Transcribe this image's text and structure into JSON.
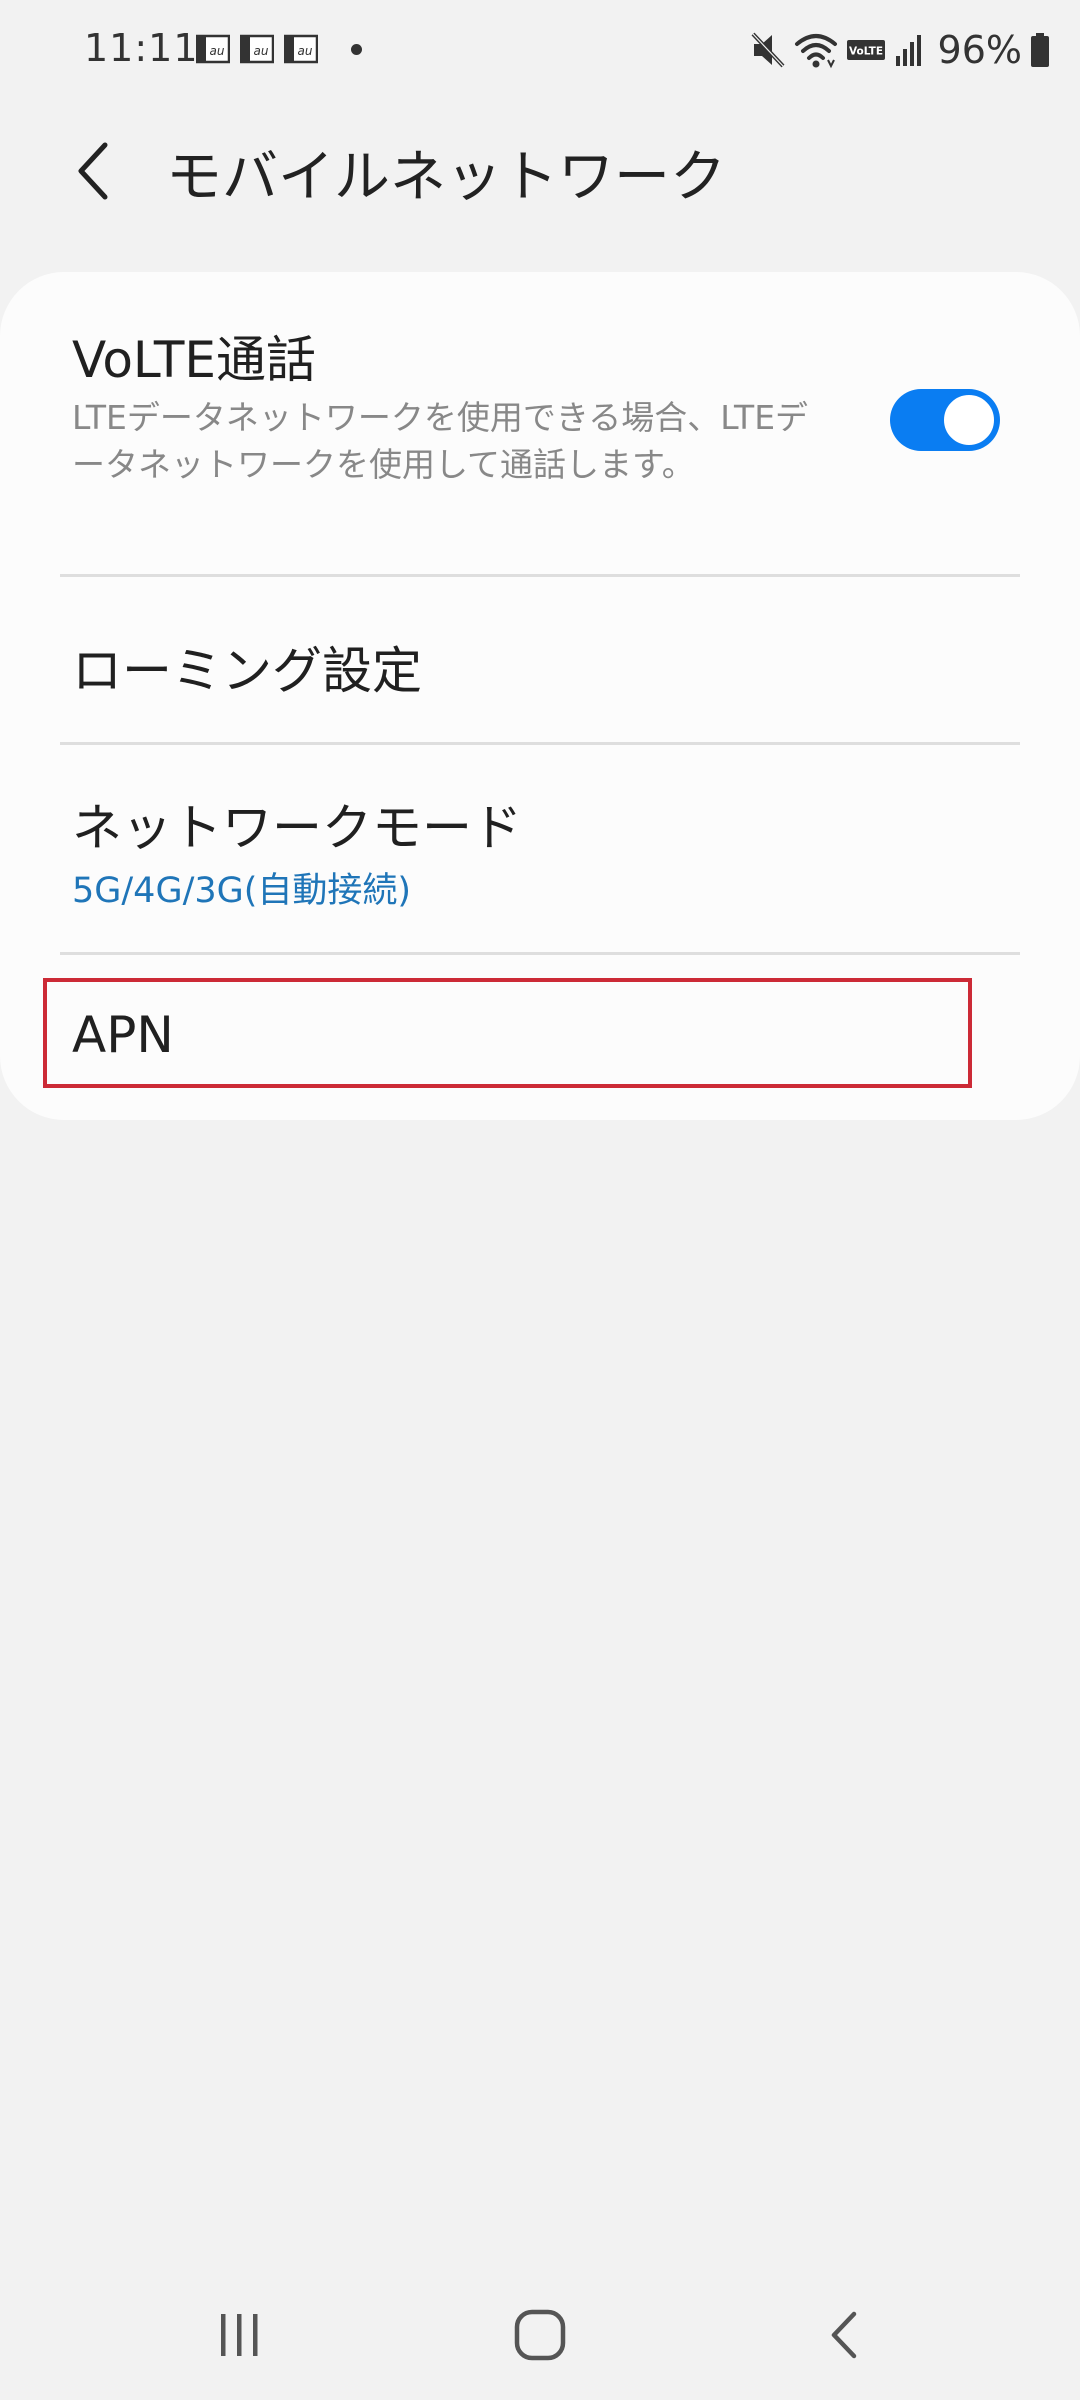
{
  "status_bar": {
    "time": "11:11",
    "sim_labels": [
      "au",
      "au",
      "au"
    ],
    "volte_badge": "VoLTE",
    "battery_percent": "96%",
    "icons": [
      "mute-icon",
      "wifi-icon",
      "volte-icon",
      "signal-icon",
      "battery-icon"
    ]
  },
  "header": {
    "title": "モバイルネットワーク",
    "back_icon": "chevron-left-icon"
  },
  "settings": {
    "volte": {
      "title": "VoLTE通話",
      "description": "LTEデータネットワークを使用できる場合、LTEデータネットワークを使用して通話します。",
      "enabled": true
    },
    "roaming": {
      "label": "ローミング設定"
    },
    "network_mode": {
      "title": "ネットワークモード",
      "value": "5G/4G/3G(自動接続)"
    },
    "apn": {
      "label": "APN"
    }
  },
  "nav_bar": {
    "buttons": [
      "recent-apps-icon",
      "home-icon",
      "back-icon"
    ]
  },
  "colors": {
    "background": "#f2f2f2",
    "card": "#fcfcfc",
    "accent": "#0a7df2",
    "link_value": "#1f75b8",
    "highlight": "#cc2a36"
  }
}
